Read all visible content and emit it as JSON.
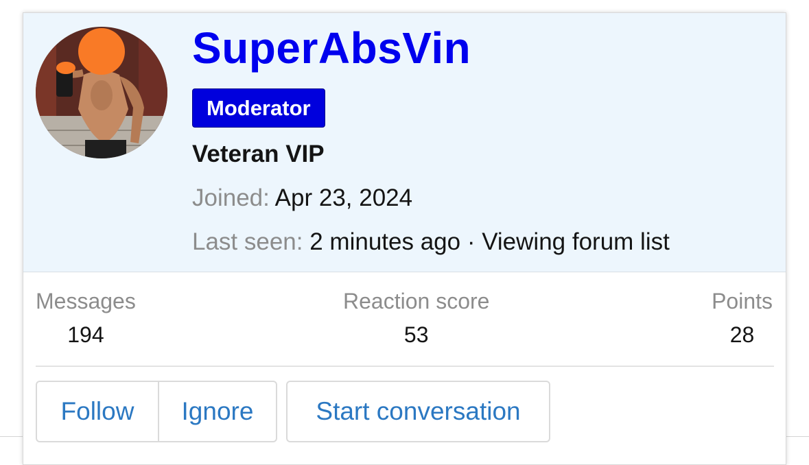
{
  "profile": {
    "username": "SuperAbsVin",
    "badge": "Moderator",
    "user_title": "Veteran VIP",
    "joined_label": "Joined:",
    "joined_value": "Apr 23, 2024",
    "last_seen_label": "Last seen:",
    "last_seen_value": "2 minutes ago · Viewing forum list",
    "avatar": "user-avatar-photo"
  },
  "stats": {
    "messages_label": "Messages",
    "messages_value": "194",
    "reaction_label": "Reaction score",
    "reaction_value": "53",
    "points_label": "Points",
    "points_value": "28"
  },
  "actions": {
    "follow": "Follow",
    "ignore": "Ignore",
    "start_conversation": "Start conversation"
  },
  "colors": {
    "username": "#0000ee",
    "badge_bg": "#0000dd",
    "header_bg": "#edf6fd",
    "link": "#2b78c2",
    "censor_dot": "#f97a26"
  }
}
